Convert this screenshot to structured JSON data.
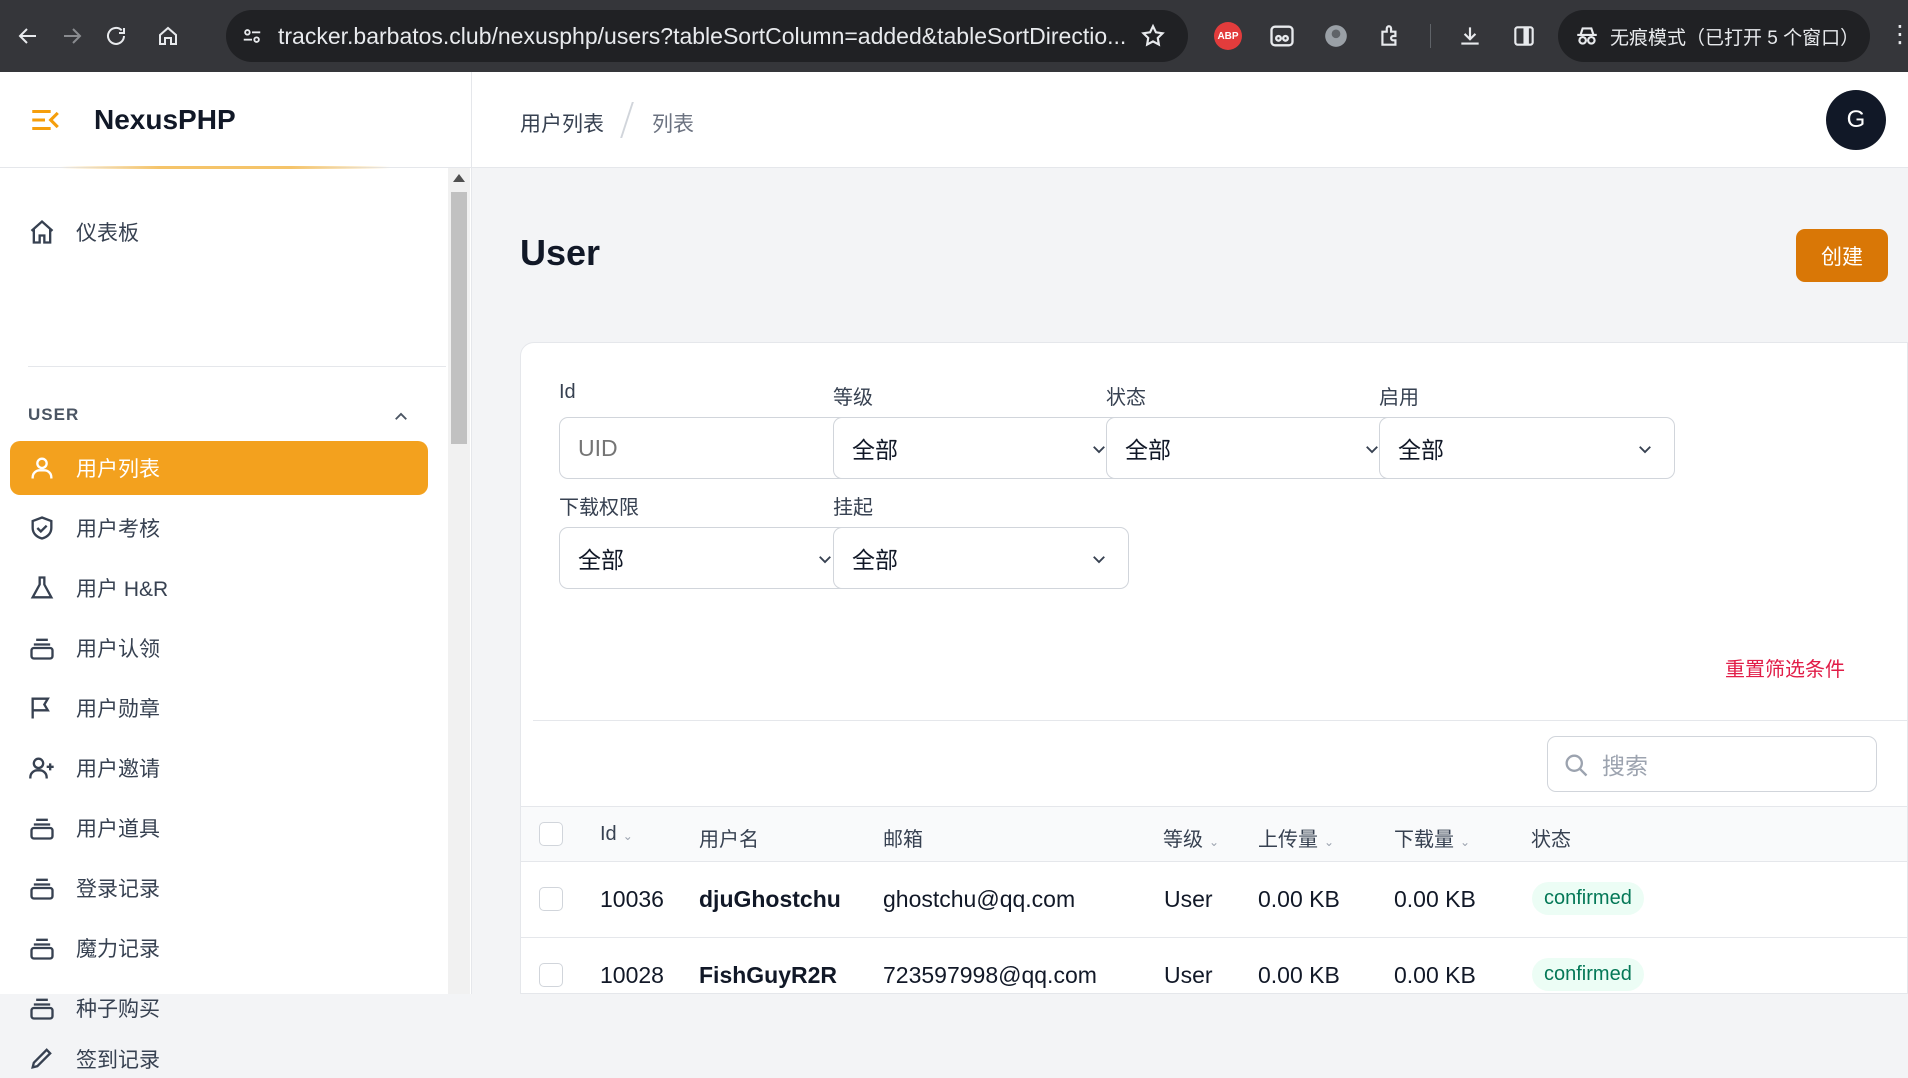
{
  "browser": {
    "url": "tracker.barbatos.club/nexusphp/users?tableSortColumn=added&tableSortDirectio...",
    "incognito_label": "无痕模式（已打开 5 个窗口）",
    "abp_label": "ABP"
  },
  "sidebar": {
    "brand": "NexusPHP",
    "dashboard": "仪表板",
    "group_label": "USER",
    "items": [
      {
        "label": "用户列表",
        "icon": "users-icon"
      },
      {
        "label": "用户考核",
        "icon": "shield-check-icon"
      },
      {
        "label": "用户 H&R",
        "icon": "flask-icon"
      },
      {
        "label": "用户认领",
        "icon": "collection-icon"
      },
      {
        "label": "用户勋章",
        "icon": "flag-icon"
      },
      {
        "label": "用户邀请",
        "icon": "user-add-icon"
      },
      {
        "label": "用户道具",
        "icon": "collection-icon"
      },
      {
        "label": "登录记录",
        "icon": "collection-icon"
      },
      {
        "label": "魔力记录",
        "icon": "collection-icon"
      },
      {
        "label": "种子购买",
        "icon": "collection-icon"
      },
      {
        "label": "签到记录",
        "icon": "pencil-icon"
      }
    ]
  },
  "topbar": {
    "crumb1": "用户列表",
    "crumb2": "列表",
    "avatar": "G"
  },
  "main": {
    "title": "User",
    "create_label": "创建",
    "filters": {
      "id_label": "Id",
      "id_placeholder": "UID",
      "class_label": "等级",
      "class_value": "全部",
      "status_label": "状态",
      "status_value": "全部",
      "enabled_label": "启用",
      "enabled_value": "全部",
      "download_label": "下载权限",
      "download_value": "全部",
      "parked_label": "挂起",
      "parked_value": "全部",
      "reset_label": "重置筛选条件"
    },
    "search_placeholder": "搜索",
    "columns": [
      "Id",
      "用户名",
      "邮箱",
      "等级",
      "上传量",
      "下载量",
      "状态"
    ],
    "rows": [
      {
        "id": "10036",
        "username": "djuGhostchu",
        "email": "ghostchu@qq.com",
        "class": "User",
        "uploaded": "0.00 KB",
        "downloaded": "0.00 KB",
        "status": "confirmed"
      },
      {
        "id": "10028",
        "username": "FishGuyR2R",
        "email": "723597998@qq.com",
        "class": "User",
        "uploaded": "0.00 KB",
        "downloaded": "0.00 KB",
        "status": "confirmed"
      }
    ]
  }
}
